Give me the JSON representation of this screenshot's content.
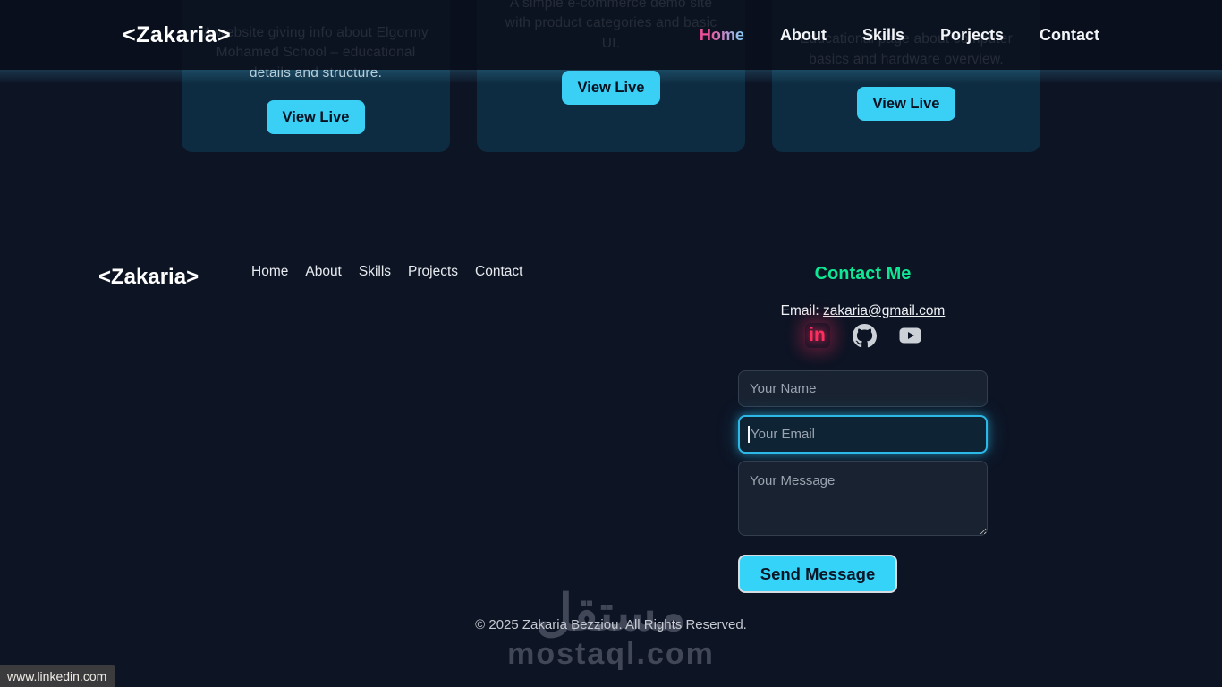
{
  "navbar": {
    "logo": "<Zakaria>",
    "links": [
      {
        "label": "Home",
        "active": true
      },
      {
        "label": "About",
        "active": false
      },
      {
        "label": "Skills",
        "active": false
      },
      {
        "label": "Porjects",
        "active": false
      },
      {
        "label": "Contact",
        "active": false
      }
    ]
  },
  "projects": {
    "cards": [
      {
        "description": "A website giving info about Elgormy Mohamed School – educational details and structure.",
        "button_label": "View Live"
      },
      {
        "description": "A simple e-commerce demo site with product categories and basic UI.",
        "button_label": "View Live"
      },
      {
        "description": "Educational page about computer basics and hardware overview.",
        "button_label": "View Live"
      }
    ]
  },
  "footer": {
    "logo": "<Zakaria>",
    "links": [
      {
        "label": "Home"
      },
      {
        "label": "About"
      },
      {
        "label": "Skills"
      },
      {
        "label": "Projects"
      },
      {
        "label": "Contact"
      }
    ],
    "contact": {
      "heading": "Contact Me",
      "email_label": "Email: ",
      "email": "zakaria@gmail.com",
      "social": {
        "linkedin_glyph": "in",
        "icons": [
          "linkedin",
          "github",
          "youtube"
        ]
      },
      "form": {
        "name_placeholder": "Your Name",
        "email_placeholder": "Your Email",
        "email_value": "",
        "message_placeholder": "Your Message",
        "submit_label": "Send Message"
      }
    },
    "copyright": "© 2025 Zakaria Bezziou. All Rights Reserved."
  },
  "watermark": {
    "arabic": "مستقل",
    "latin": "mostaql.com"
  },
  "statusbar": {
    "link_preview_url": "www.linkedin.com"
  },
  "colors": {
    "page_bg": "#0d1424",
    "card_bg": "#0e2c41",
    "accent_cyan": "#3ad0f6",
    "active_link_pink": "#f0509b",
    "active_link_blue": "#8cc3f0",
    "heading_green": "#10e794",
    "linkedin_pink": "#ff2e5f",
    "focus_border": "#2cb9e8"
  }
}
